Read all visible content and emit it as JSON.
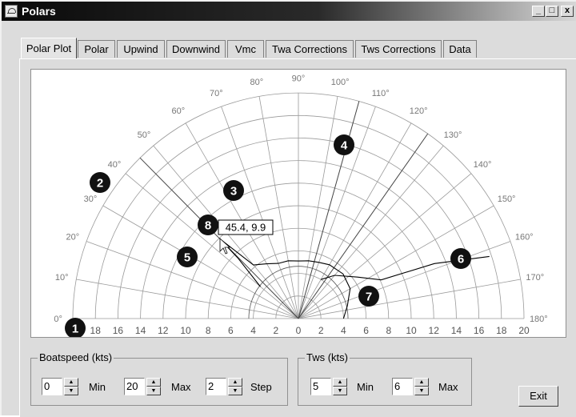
{
  "window": {
    "title": "Polars",
    "controls": [
      "_",
      "□",
      "x"
    ]
  },
  "tabs": [
    "Polar Plot",
    "Polar",
    "Upwind",
    "Downwind",
    "Vmc",
    "Twa Corrections",
    "Tws Corrections",
    "Data"
  ],
  "active_tab": "Polar Plot",
  "plot": {
    "angle_labels": [
      "0°",
      "10°",
      "20°",
      "30°",
      "40°",
      "50°",
      "60°",
      "70°",
      "80°",
      "90°",
      "100°",
      "110°",
      "120°",
      "130°",
      "140°",
      "150°",
      "160°",
      "170°",
      "180°"
    ],
    "speed_labels_left": [
      "18",
      "16",
      "14",
      "12",
      "10",
      "8",
      "6",
      "4",
      "2",
      "0"
    ],
    "speed_labels_right": [
      "2",
      "4",
      "6",
      "8",
      "10",
      "12",
      "14",
      "16",
      "18",
      "20"
    ],
    "tooltip": "45.4, 9.9",
    "callouts": [
      "1",
      "2",
      "3",
      "4",
      "5",
      "6",
      "7",
      "8"
    ],
    "colors": {
      "grid": "#9a9a9a",
      "curve": "#000000",
      "callout": "#111111"
    }
  },
  "chart_data": {
    "type": "polar",
    "r_max": 20,
    "r_step": 2,
    "angle_step_deg": 10,
    "curves": [
      {
        "points": [
          [
            40,
            4.4
          ],
          [
            45,
            7.6
          ],
          [
            45.4,
            9.9
          ],
          [
            50,
            6.2
          ],
          [
            60,
            5.6
          ],
          [
            70,
            5.2
          ],
          [
            80,
            5.2
          ],
          [
            90,
            5.1
          ],
          [
            100,
            5.2
          ],
          [
            110,
            5.3
          ],
          [
            120,
            5.5
          ],
          [
            135,
            5.6
          ],
          [
            150,
            5.3
          ],
          [
            165,
            4.5
          ],
          [
            180,
            4.0
          ]
        ]
      },
      {
        "points": [
          [
            120,
            4.0
          ],
          [
            130,
            5.0
          ],
          [
            145,
            6.4
          ],
          [
            155,
            8.1
          ],
          [
            158,
            13.0
          ],
          [
            162,
            17.8
          ]
        ]
      }
    ],
    "rays_deg": [
      45.4,
      105.6,
      125.0
    ]
  },
  "boatspeed": {
    "label": "Boatspeed (kts)",
    "min": {
      "value": "0",
      "label": "Min"
    },
    "max": {
      "value": "20",
      "label": "Max"
    },
    "step": {
      "value": "2",
      "label": "Step"
    }
  },
  "tws": {
    "label": "Tws (kts)",
    "min": {
      "value": "5",
      "label": "Min"
    },
    "max": {
      "value": "6",
      "label": "Max"
    }
  },
  "exit_label": "Exit"
}
